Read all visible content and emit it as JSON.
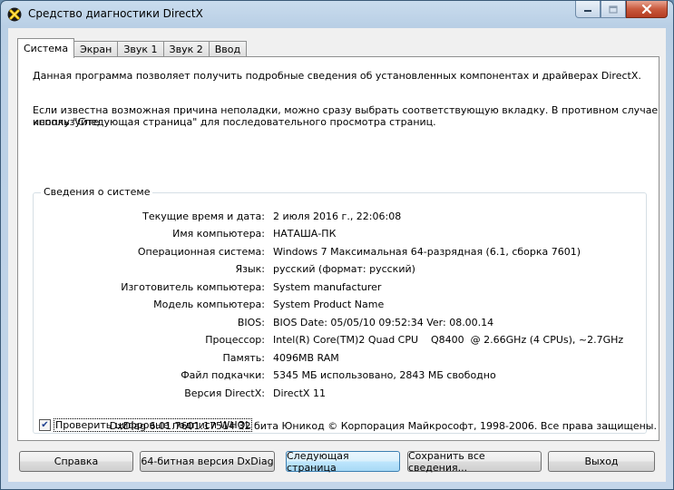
{
  "window": {
    "title": "Средство диагностики DirectX",
    "caption_buttons": [
      "minimize-icon",
      "maximize-icon",
      "close-icon"
    ]
  },
  "tabs": [
    {
      "label": "Система",
      "active": true
    },
    {
      "label": "Экран",
      "active": false
    },
    {
      "label": "Звук 1",
      "active": false
    },
    {
      "label": "Звук 2",
      "active": false
    },
    {
      "label": "Ввод",
      "active": false
    }
  ],
  "intro": {
    "line1": "Данная программа позволяет получить подробные сведения об установленных компонентах и драйверах DirectX.",
    "line2": "Если известна возможная причина неполадки, можно сразу выбрать соответствующую вкладку. В противном случае используйте",
    "line3": "кнопку \"Следующая страница\" для последовательного просмотра страниц."
  },
  "system_info": {
    "title": "Сведения о системе",
    "rows": [
      {
        "label": "Текущие время и дата:",
        "value": "2 июля 2016 г., 22:06:08"
      },
      {
        "label": "Имя компьютера:",
        "value": "НАТАША-ПК"
      },
      {
        "label": "Операционная система:",
        "value": "Windows 7 Максимальная 64-разрядная (6.1, сборка 7601)"
      },
      {
        "label": "Язык:",
        "value": "русский (формат: русский)"
      },
      {
        "label": "Изготовитель компьютера:",
        "value": "System manufacturer"
      },
      {
        "label": "Модель компьютера:",
        "value": "System Product Name"
      },
      {
        "label": "BIOS:",
        "value": "BIOS Date: 05/05/10 09:52:34 Ver: 08.00.14"
      },
      {
        "label": "Процессор:",
        "value": "Intel(R) Core(TM)2 Quad CPU    Q8400  @ 2.66GHz (4 CPUs), ~2.7GHz"
      },
      {
        "label": "Память:",
        "value": "4096MB RAM"
      },
      {
        "label": "Файл подкачки:",
        "value": "5345 МБ использовано, 2843 МБ свободно"
      },
      {
        "label": "Версия DirectX:",
        "value": "DirectX 11"
      }
    ],
    "whql_checkbox": {
      "label": "Проверить цифровые подписи WHQL",
      "checked": true
    }
  },
  "footer_text": "DxDiag 6.01.7601.17514 32 бита Юникод  © Корпорация Майкрософт, 1998-2006.  Все права защищены.",
  "buttons": {
    "help": "Справка",
    "dxdiag64": "64-битная версия DxDiag",
    "next_page": "Следующая страница",
    "save_all": "Сохранить все сведения...",
    "exit": "Выход"
  },
  "colors": {
    "frame": "#c4d6ea",
    "close_button": "#c95a3e",
    "default_button": "#bee6fd"
  }
}
